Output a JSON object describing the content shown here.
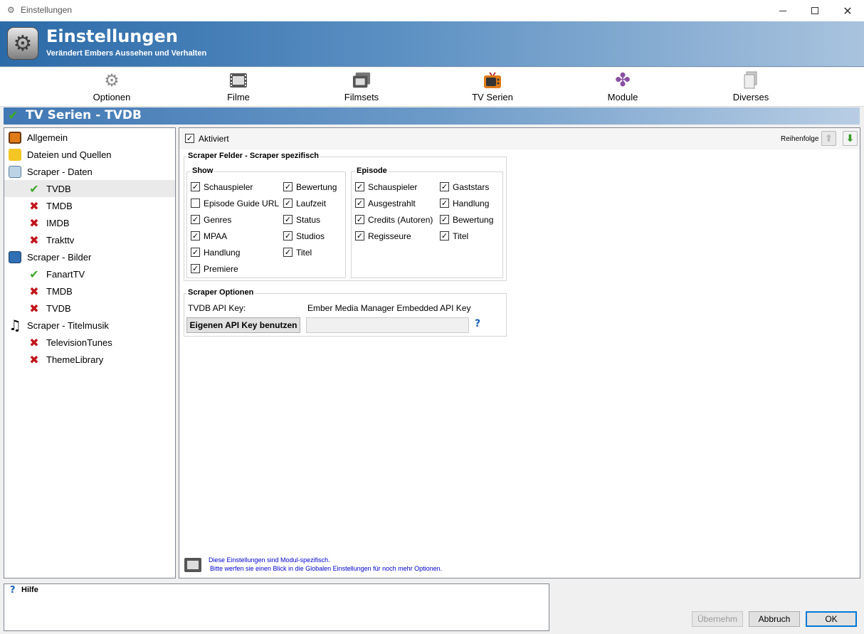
{
  "window": {
    "title": "Einstellungen",
    "controls": [
      "minimize-icon",
      "maximize-icon",
      "close-icon"
    ]
  },
  "banner": {
    "title": "Einstellungen",
    "subtitle": "Verändert Embers Aussehen und Verhalten"
  },
  "toolbar": {
    "items": [
      {
        "label": "Optionen",
        "icon": "gear-icon"
      },
      {
        "label": "Filme",
        "icon": "film-icon"
      },
      {
        "label": "Filmsets",
        "icon": "filmset-icon"
      },
      {
        "label": "TV Serien",
        "icon": "tv-icon"
      },
      {
        "label": "Module",
        "icon": "puzzle-icon"
      },
      {
        "label": "Diverses",
        "icon": "document-icon"
      }
    ]
  },
  "section": {
    "title": "TV Serien - TVDB"
  },
  "tree": {
    "nodes": [
      {
        "label": "Allgemein",
        "icon": "tv-icon"
      },
      {
        "label": "Dateien und Quellen",
        "icon": "folder-icon"
      },
      {
        "label": "Scraper - Daten",
        "icon": "data-icon"
      },
      {
        "label": "TVDB",
        "icon": "enabled-check-icon",
        "selected": true
      },
      {
        "label": "TMDB",
        "icon": "disabled-x-icon"
      },
      {
        "label": "IMDB",
        "icon": "disabled-x-icon"
      },
      {
        "label": "Trakttv",
        "icon": "disabled-x-icon"
      },
      {
        "label": "Scraper - Bilder",
        "icon": "image-icon"
      },
      {
        "label": "FanartTV",
        "icon": "enabled-check-icon"
      },
      {
        "label": "TMDB",
        "icon": "disabled-x-icon"
      },
      {
        "label": "TVDB",
        "icon": "disabled-x-icon"
      },
      {
        "label": "Scraper - Titelmusik",
        "icon": "music-icon"
      },
      {
        "label": "TelevisionTunes",
        "icon": "disabled-x-icon"
      },
      {
        "label": "ThemeLibrary",
        "icon": "disabled-x-icon"
      }
    ]
  },
  "main": {
    "enabled_label": "Aktiviert",
    "enabled": true,
    "order_label": "Reihenfolge",
    "fields_group_title": "Scraper Felder - Scraper spezifisch",
    "show_title": "Show",
    "show_fields": [
      {
        "label": "Schauspieler",
        "checked": true
      },
      {
        "label": "Bewertung",
        "checked": true
      },
      {
        "label": "Episode Guide URL",
        "checked": false
      },
      {
        "label": "Laufzeit",
        "checked": true
      },
      {
        "label": "Genres",
        "checked": true
      },
      {
        "label": "Status",
        "checked": true
      },
      {
        "label": "MPAA",
        "checked": true
      },
      {
        "label": "Studios",
        "checked": true
      },
      {
        "label": "Handlung",
        "checked": true
      },
      {
        "label": "Titel",
        "checked": true
      },
      {
        "label": "Premiere",
        "checked": true
      }
    ],
    "episode_title": "Episode",
    "episode_fields": [
      {
        "label": "Schauspieler",
        "checked": true
      },
      {
        "label": "Gaststars",
        "checked": true
      },
      {
        "label": "Ausgestrahlt",
        "checked": true
      },
      {
        "label": "Handlung",
        "checked": true
      },
      {
        "label": "Credits (Autoren)",
        "checked": true
      },
      {
        "label": "Bewertung",
        "checked": true
      },
      {
        "label": "Regisseure",
        "checked": true
      },
      {
        "label": "Titel",
        "checked": true
      }
    ],
    "options_title": "Scraper Optionen",
    "api_key_label": "TVDB API Key:",
    "api_key_value": "Ember Media Manager Embedded API Key",
    "api_button": "Eigenen API Key benutzen",
    "api_input_value": "",
    "help_glyph": "?",
    "footer_note_1": "Diese Einstellungen sind Modul-spezifisch.",
    "footer_note_2": "Bitte werfen sie einen Blick in die Globalen Einstellungen für noch mehr Optionen."
  },
  "help": {
    "title": "Hilfe",
    "glyph": "?"
  },
  "buttons": {
    "apply": "Übernehm",
    "cancel": "Abbruch",
    "ok": "OK"
  },
  "colors": {
    "banner_start": "#2b6aa8",
    "enabled_green": "#3ea82c",
    "disabled_red": "#c0141a",
    "link_blue": "#0000cc"
  }
}
